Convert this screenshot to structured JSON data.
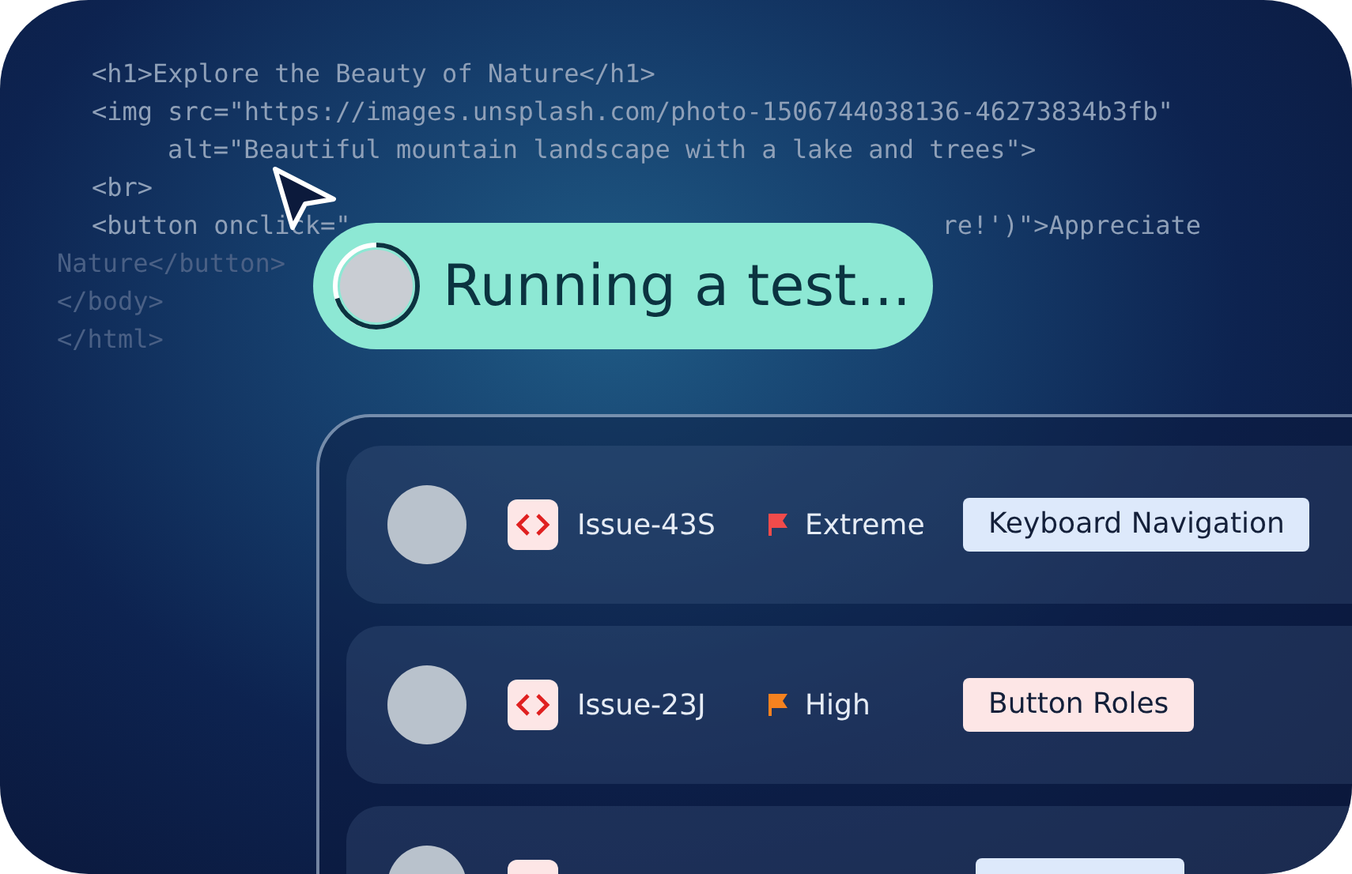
{
  "code_lines": [
    {
      "kind": "nested",
      "segments": [
        "<h1>Explore the Beauty of Nature</h1>"
      ]
    },
    {
      "kind": "nested",
      "segments": [
        "<img src=\"https://images.unsplash.com/photo-1506744038136-46273834b3fb\""
      ],
      "children": [
        {
          "kind": "nested",
          "segments": [
            "alt=\"Beautiful mountain landscape with a lake and trees\">"
          ]
        }
      ]
    },
    {
      "kind": "nested",
      "segments": [
        "<br>"
      ]
    },
    {
      "kind": "nested",
      "segments": [
        "<button onclick=\"",
        "re!')\">Appreciate"
      ]
    },
    {
      "kind": "top",
      "segments": [
        "Nature</button>"
      ]
    },
    {
      "kind": "top",
      "segments": [
        "</body>"
      ]
    },
    {
      "kind": "top",
      "segments": [
        "</html>"
      ]
    }
  ],
  "status_pill": {
    "label": "Running a test...",
    "progress": {
      "level": 0.7
    }
  },
  "issues": [
    {
      "issue": "Issue-43S",
      "priority": {
        "label": "Extreme",
        "color": "#f04b4b"
      },
      "tag": {
        "label": "Keyboard Navigation",
        "color": "#dde9fb"
      }
    },
    {
      "issue": "Issue-23J",
      "priority": {
        "label": "High",
        "color": "#f5821f"
      },
      "tag": {
        "label": "Button Roles",
        "color": "#fde6e6"
      }
    },
    {
      "tag": {
        "color": "#dde9fb"
      }
    }
  ]
}
